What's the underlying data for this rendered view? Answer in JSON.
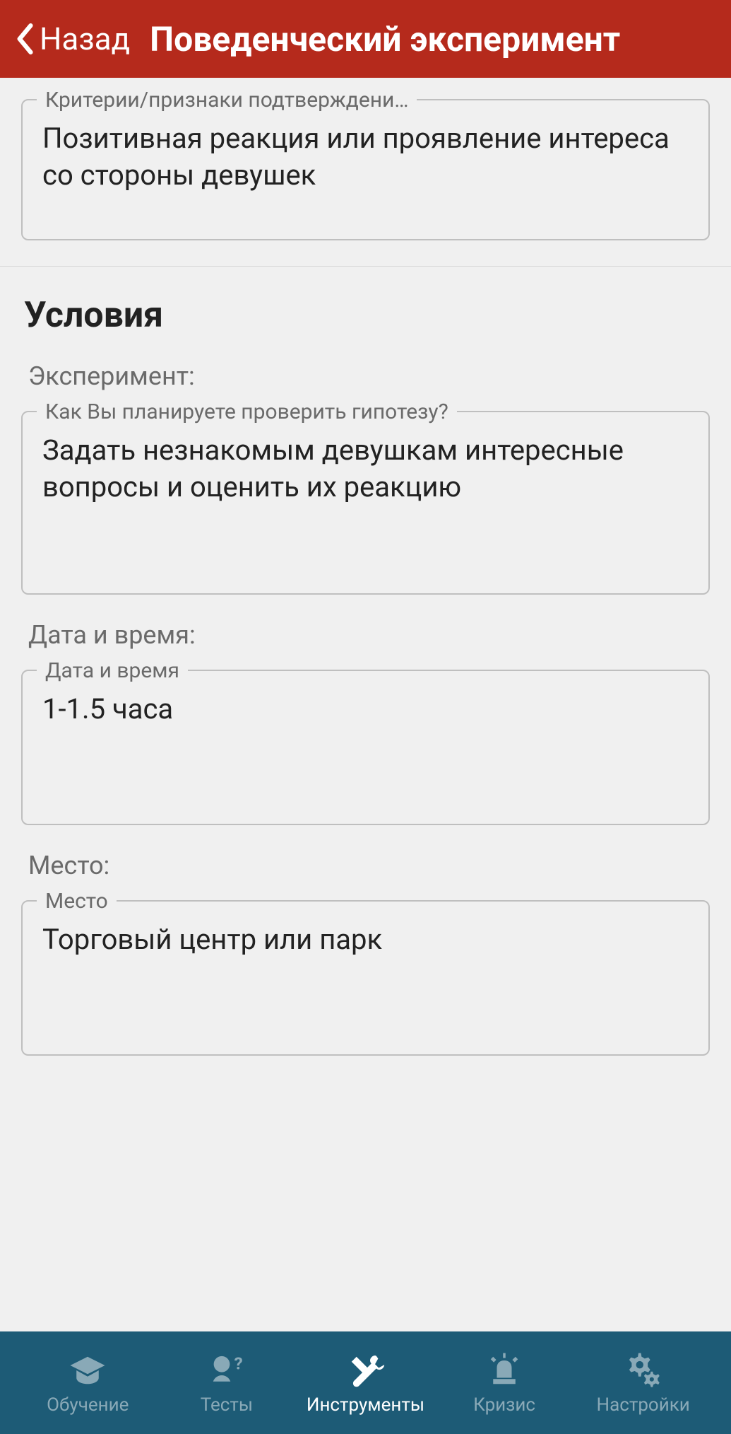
{
  "header": {
    "back_label": "Назад",
    "title": "Поведенческий эксперимент"
  },
  "criteria_field": {
    "legend": "Критерии/признаки подтверждени…",
    "value": "Позитивная реакция или проявление интереса со стороны девушек"
  },
  "conditions": {
    "section_title": "Условия",
    "experiment": {
      "label": "Эксперимент:",
      "legend": "Как Вы планируете проверить гипотезу?",
      "value": "Задать незнакомым девушкам интересные вопросы и оценить их реакцию"
    },
    "datetime": {
      "label": "Дата и время:",
      "legend": "Дата и время",
      "value": "1-1.5 часа"
    },
    "place": {
      "label": "Место:",
      "legend": "Место",
      "value": "Торговый центр или парк"
    }
  },
  "nav": {
    "items": [
      {
        "label": "Обучение",
        "icon": "graduation-icon"
      },
      {
        "label": "Тесты",
        "icon": "question-icon"
      },
      {
        "label": "Инструменты",
        "icon": "tools-icon"
      },
      {
        "label": "Кризис",
        "icon": "siren-icon"
      },
      {
        "label": "Настройки",
        "icon": "gears-icon"
      }
    ],
    "active_index": 2
  }
}
